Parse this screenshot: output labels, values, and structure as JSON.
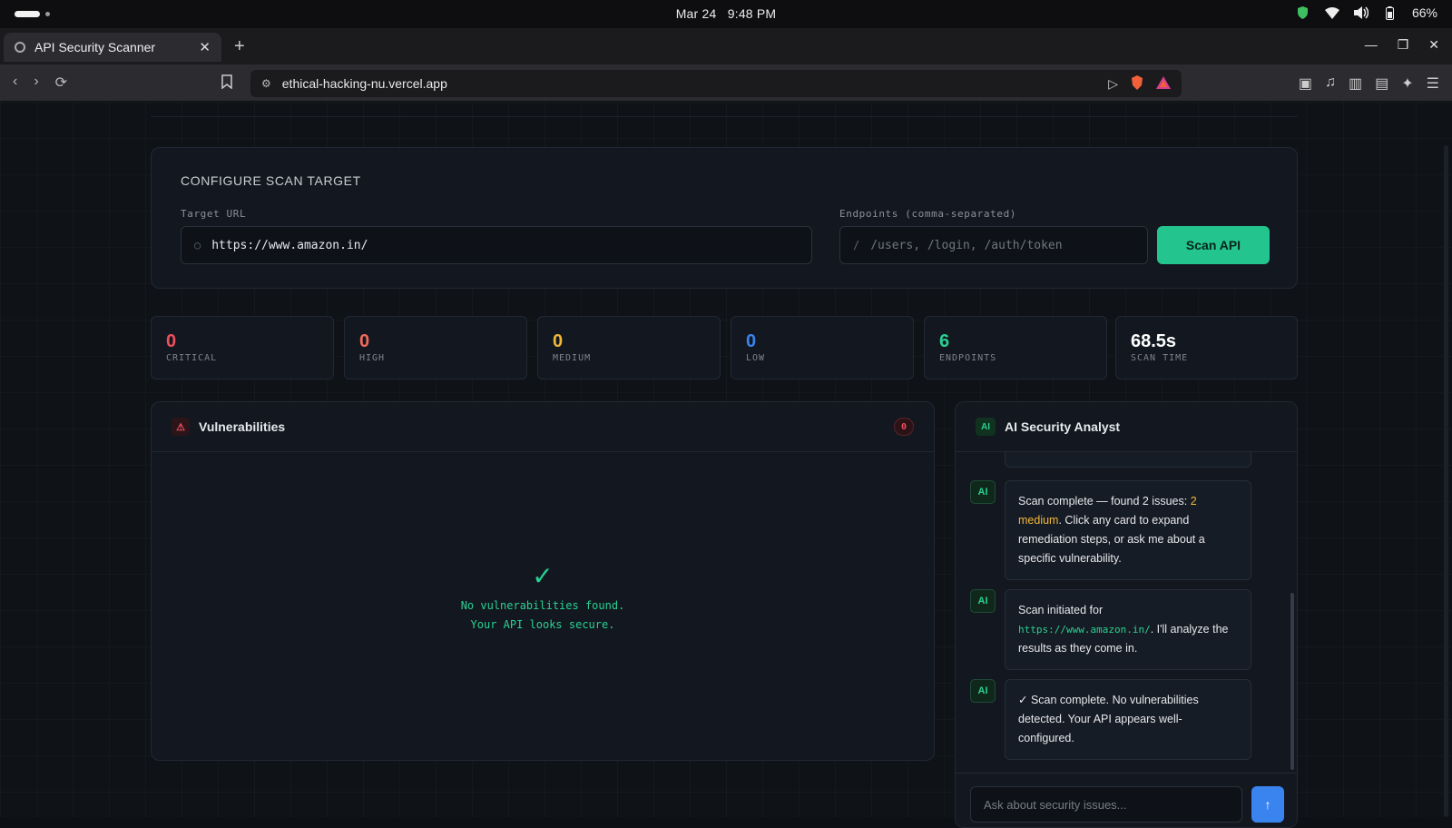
{
  "os": {
    "date": "Mar 24",
    "time": "9:48 PM",
    "battery": "66%"
  },
  "browser": {
    "tab_title": "API Security Scanner",
    "url": "ethical-hacking-nu.vercel.app"
  },
  "config": {
    "heading": "CONFIGURE SCAN TARGET",
    "target_label": "Target URL",
    "target_value": "https://www.amazon.in/",
    "endpoints_label": "Endpoints (comma-separated)",
    "endpoints_placeholder": "/users, /login, /auth/token",
    "endpoints_prefix": "/",
    "scan_button": "Scan API"
  },
  "stats": [
    {
      "value": "0",
      "label": "CRITICAL",
      "color": "#ef4f5f"
    },
    {
      "value": "0",
      "label": "HIGH",
      "color": "#f26b5b"
    },
    {
      "value": "0",
      "label": "MEDIUM",
      "color": "#f2b838"
    },
    {
      "value": "0",
      "label": "LOW",
      "color": "#3a84f0"
    },
    {
      "value": "6",
      "label": "ENDPOINTS",
      "color": "#2ad091"
    },
    {
      "value": "68.5s",
      "label": "SCAN TIME",
      "color": "#ffffff"
    }
  ],
  "vulnerabilities": {
    "title": "Vulnerabilities",
    "count": "0",
    "empty_line1": "No vulnerabilities found.",
    "empty_line2": "Your API looks secure."
  },
  "ai_panel": {
    "title": "AI Security Analyst",
    "avatar": "AI",
    "messages": [
      {
        "part1": "Scan complete — found 2 issues: ",
        "highlight": "2 medium",
        "part2": ". Click any card to expand remediation steps, or ask me about a specific vulnerability."
      },
      {
        "part1": "Scan initiated for ",
        "code": "https://www.amazon.in/",
        "part2": ". I'll analyze the results as they come in."
      },
      {
        "text": "✓ Scan complete. No vulnerabilities detected. Your API appears well-configured."
      }
    ],
    "input_placeholder": "Ask about security issues...",
    "send_icon": "↑"
  }
}
